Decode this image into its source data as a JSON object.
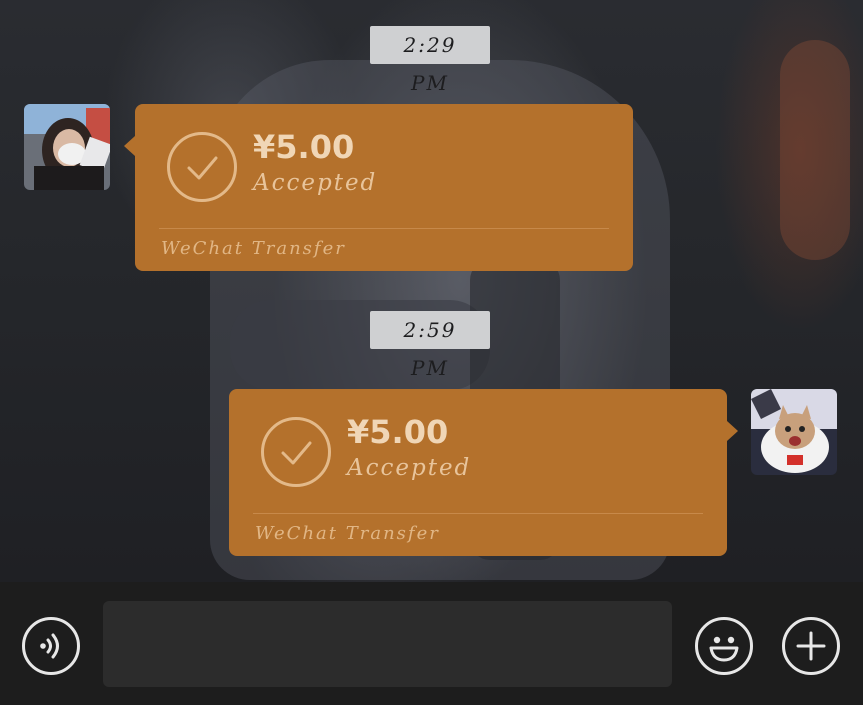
{
  "chat": {
    "messages": [
      {
        "time": "2:29 PM",
        "side": "left",
        "type": "transfer",
        "amount": "¥5.00",
        "status": "Accepted",
        "footer": "WeChat Transfer"
      },
      {
        "time": "2:59 PM",
        "side": "right",
        "type": "transfer",
        "amount": "¥5.00",
        "status": "Accepted",
        "footer": "WeChat Transfer"
      }
    ]
  },
  "input_bar": {
    "voice_icon": "voice-mode-icon",
    "emoji_icon": "emoji-icon",
    "more_icon": "plus-icon"
  },
  "colors": {
    "transfer_bubble": "#b4712c",
    "timestamp_bg": "#cfd0d2",
    "input_bar_bg": "#1d1d1d"
  }
}
